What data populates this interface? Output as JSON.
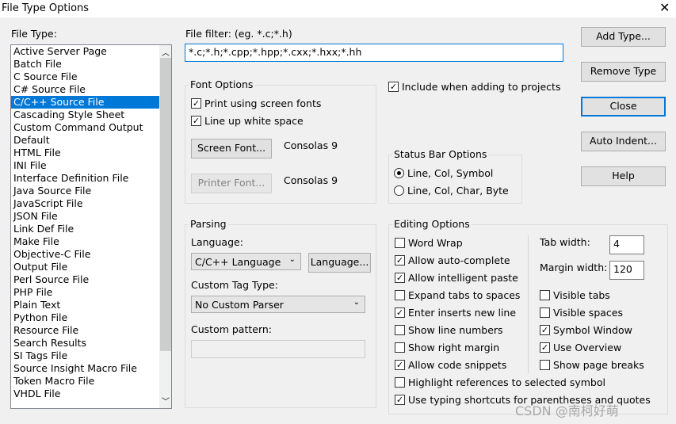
{
  "window": {
    "title": "File Type Options",
    "close_icon": "close-icon"
  },
  "file_type": {
    "label": "File Type:",
    "items": [
      "Active Server Page",
      "Batch File",
      "C Source File",
      "C# Source File",
      "C/C++ Source File",
      "Cascading Style Sheet",
      "Custom Command Output",
      "Default",
      "HTML File",
      "INI File",
      "Interface Definition File",
      "Java Source File",
      "JavaScript File",
      "JSON File",
      "Link Def File",
      "Make File",
      "Objective-C File",
      "Output File",
      "Perl Source File",
      "PHP File",
      "Plain Text",
      "Python File",
      "Resource File",
      "Search Results",
      "SI Tags File",
      "Source Insight Macro File",
      "Token Macro File",
      "VHDL File"
    ],
    "selected": "C/C++ Source File"
  },
  "file_filter": {
    "label": "File filter: (eg. *.c;*.h)",
    "value": "*.c;*.h;*.cpp;*.hpp;*.cxx;*.hxx;*.hh"
  },
  "font_options": {
    "label": "Font Options",
    "print_screen_fonts": {
      "label": "Print using screen fonts",
      "checked": true
    },
    "line_up_white": {
      "label": "Line up white space",
      "checked": true
    },
    "screen_font_button": "Screen Font...",
    "screen_font_value": "Consolas 9",
    "printer_font_button": "Printer Font...",
    "printer_font_value": "Consolas 9"
  },
  "include_projects": {
    "label": "Include when adding to projects",
    "checked": true
  },
  "status_bar": {
    "label": "Status Bar Options",
    "options": [
      "Line, Col, Symbol",
      "Line, Col, Char, Byte"
    ],
    "selected": "Line, Col, Symbol"
  },
  "parsing": {
    "label": "Parsing",
    "language_label": "Language:",
    "language_value": "C/C++ Language",
    "language_button": "Language...",
    "custom_tag_label": "Custom Tag Type:",
    "custom_tag_value": "No Custom Parser",
    "custom_pattern_label": "Custom pattern:",
    "custom_pattern_value": ""
  },
  "editing": {
    "label": "Editing Options",
    "left": [
      {
        "label": "Word Wrap",
        "checked": false
      },
      {
        "label": "Allow auto-complete",
        "checked": true
      },
      {
        "label": "Allow intelligent paste",
        "checked": true
      },
      {
        "label": "Expand tabs to spaces",
        "checked": false
      },
      {
        "label": "Enter inserts new line",
        "checked": true
      },
      {
        "label": "Show line numbers",
        "checked": false
      },
      {
        "label": "Show right margin",
        "checked": false
      },
      {
        "label": "Allow code snippets",
        "checked": true
      }
    ],
    "right": [
      {
        "label": "Visible tabs",
        "checked": false
      },
      {
        "label": "Visible spaces",
        "checked": false
      },
      {
        "label": "Symbol Window",
        "checked": true
      },
      {
        "label": "Use Overview",
        "checked": true
      },
      {
        "label": "Show page breaks",
        "checked": false
      }
    ],
    "bottom": [
      {
        "label": "Highlight references to selected symbol",
        "checked": false
      },
      {
        "label": "Use typing shortcuts for parentheses and quotes",
        "checked": true
      }
    ],
    "tab_width_label": "Tab width:",
    "tab_width": "4",
    "margin_width_label": "Margin width:",
    "margin_width": "120"
  },
  "buttons": {
    "add_type": "Add Type...",
    "remove_type": "Remove Type",
    "close": "Close",
    "auto_indent": "Auto Indent...",
    "help": "Help"
  },
  "watermark": "CSDN @南柯好萌"
}
